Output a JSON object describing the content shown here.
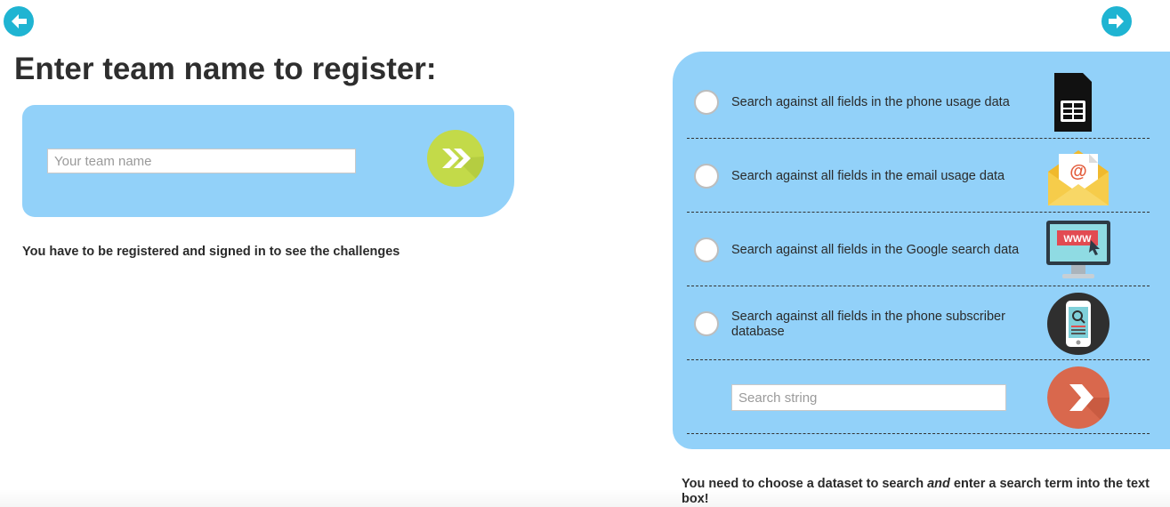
{
  "nav": {
    "back_icon": "arrow-left-icon",
    "next_icon": "arrow-right-icon",
    "accent": "#1fb4d2"
  },
  "register": {
    "title": "Enter team name to register:",
    "team_placeholder": "Your team name",
    "team_value": "",
    "go_icon": "double-chevron-right-icon",
    "go_color": "#c3da49",
    "note": "You have to be registered and signed in to see the challenges"
  },
  "search": {
    "panel_color": "#92d1f9",
    "options": [
      {
        "label": "Search against all fields in the phone usage data",
        "icon": "sim-card-icon",
        "selected": false
      },
      {
        "label": "Search against all fields in the email usage data",
        "icon": "envelope-icon",
        "selected": false
      },
      {
        "label": "Search against all fields in the Google search data",
        "icon": "monitor-www-icon",
        "selected": false
      },
      {
        "label": "Search against all fields in the phone subscriber database",
        "icon": "smartphone-icon",
        "selected": false
      }
    ],
    "monitor_text": "WWW",
    "email_symbol": "@",
    "search_placeholder": "Search string",
    "search_value": "",
    "go_icon": "chevron-right-icon",
    "go_color": "#d9684d",
    "note_before": "You need to choose a dataset to search ",
    "note_emphasis": "and",
    "note_after": " enter a search term into the text box!"
  }
}
